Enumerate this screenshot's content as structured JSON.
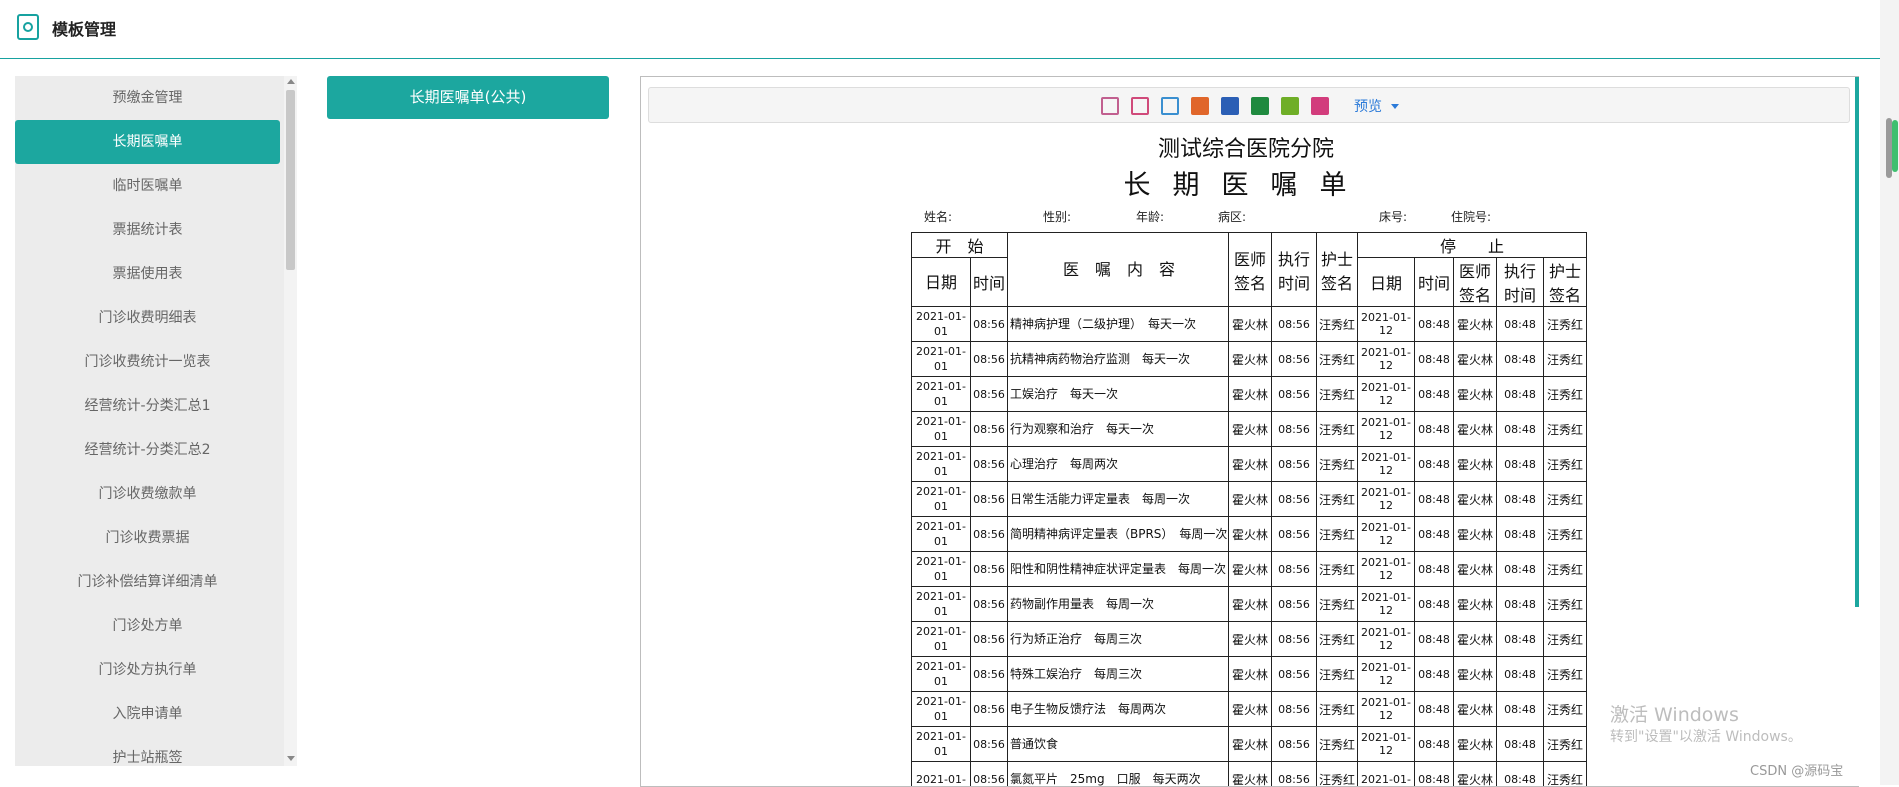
{
  "app": {
    "title": "模板管理"
  },
  "sidebar": {
    "items": [
      {
        "label": "预缴金管理"
      },
      {
        "label": "长期医嘱单",
        "active": true
      },
      {
        "label": "临时医嘱单"
      },
      {
        "label": "票据统计表"
      },
      {
        "label": "票据使用表"
      },
      {
        "label": "门诊收费明细表"
      },
      {
        "label": "门诊收费统计一览表"
      },
      {
        "label": "经营统计-分类汇总1"
      },
      {
        "label": "经营统计-分类汇总2"
      },
      {
        "label": "门诊收费缴款单"
      },
      {
        "label": "门诊收费票据"
      },
      {
        "label": "门诊补偿结算详细清单"
      },
      {
        "label": "门诊处方单"
      },
      {
        "label": "门诊处方执行单"
      },
      {
        "label": "入院申请单"
      },
      {
        "label": "护士站瓶签"
      }
    ]
  },
  "template_button": {
    "label": "长期医嘱单(公共)"
  },
  "toolbar": {
    "icons": [
      {
        "name": "print-preview-icon",
        "color": "#c15f8f"
      },
      {
        "name": "print-icon",
        "color": "#d04a7a"
      },
      {
        "name": "quick-print-icon",
        "color": "#3a8fd0"
      },
      {
        "name": "pdf-icon",
        "color": "#e0662a"
      },
      {
        "name": "word-icon",
        "color": "#2b5fb5"
      },
      {
        "name": "excel-icon",
        "color": "#1f8a3f"
      },
      {
        "name": "excel-green-icon",
        "color": "#6fae27"
      },
      {
        "name": "excel-pink-icon",
        "color": "#d23c7c"
      }
    ],
    "preview_label": "预览"
  },
  "report": {
    "hospital": "测试综合医院分院",
    "title": "长期医嘱单",
    "patient": {
      "name_label": "姓名:",
      "gender_label": "性别:",
      "age_label": "年龄:",
      "ward_label": "病区:",
      "bed_label": "床号:",
      "admission_label": "住院号:"
    },
    "headers": {
      "start": "开　始",
      "stop": "停　　止",
      "content": "医　嘱　内　容",
      "date": "日期",
      "time": "时间",
      "doctor_sig": "医师签名",
      "exec_time": "执行时间",
      "nurse_sig": "护士签名"
    },
    "rows": [
      {
        "d1": "2021-01-01",
        "t1": "08:56",
        "content": "精神病护理（二级护理）　每天一次",
        "doc": "霍火林",
        "exec": "08:56",
        "nurse": "汪秀红",
        "d2": "2021-01-12",
        "t2": "08:48",
        "doc2": "霍火林",
        "exec2": "08:48",
        "nurse2": "汪秀红"
      },
      {
        "d1": "2021-01-01",
        "t1": "08:56",
        "content": "抗精神病药物治疗监测　每天一次",
        "doc": "霍火林",
        "exec": "08:56",
        "nurse": "汪秀红",
        "d2": "2021-01-12",
        "t2": "08:48",
        "doc2": "霍火林",
        "exec2": "08:48",
        "nurse2": "汪秀红"
      },
      {
        "d1": "2021-01-01",
        "t1": "08:56",
        "content": "工娱治疗　每天一次",
        "doc": "霍火林",
        "exec": "08:56",
        "nurse": "汪秀红",
        "d2": "2021-01-12",
        "t2": "08:48",
        "doc2": "霍火林",
        "exec2": "08:48",
        "nurse2": "汪秀红"
      },
      {
        "d1": "2021-01-01",
        "t1": "08:56",
        "content": "行为观察和治疗　每天一次",
        "doc": "霍火林",
        "exec": "08:56",
        "nurse": "汪秀红",
        "d2": "2021-01-12",
        "t2": "08:48",
        "doc2": "霍火林",
        "exec2": "08:48",
        "nurse2": "汪秀红"
      },
      {
        "d1": "2021-01-01",
        "t1": "08:56",
        "content": "心理治疗　每周两次",
        "doc": "霍火林",
        "exec": "08:56",
        "nurse": "汪秀红",
        "d2": "2021-01-12",
        "t2": "08:48",
        "doc2": "霍火林",
        "exec2": "08:48",
        "nurse2": "汪秀红"
      },
      {
        "d1": "2021-01-01",
        "t1": "08:56",
        "content": "日常生活能力评定量表　每周一次",
        "doc": "霍火林",
        "exec": "08:56",
        "nurse": "汪秀红",
        "d2": "2021-01-12",
        "t2": "08:48",
        "doc2": "霍火林",
        "exec2": "08:48",
        "nurse2": "汪秀红"
      },
      {
        "d1": "2021-01-01",
        "t1": "08:56",
        "content": "简明精神病评定量表（BPRS）　每周一次",
        "doc": "霍火林",
        "exec": "08:56",
        "nurse": "汪秀红",
        "d2": "2021-01-12",
        "t2": "08:48",
        "doc2": "霍火林",
        "exec2": "08:48",
        "nurse2": "汪秀红"
      },
      {
        "d1": "2021-01-01",
        "t1": "08:56",
        "content": "阳性和阴性精神症状评定量表　每周一次",
        "doc": "霍火林",
        "exec": "08:56",
        "nurse": "汪秀红",
        "d2": "2021-01-12",
        "t2": "08:48",
        "doc2": "霍火林",
        "exec2": "08:48",
        "nurse2": "汪秀红"
      },
      {
        "d1": "2021-01-01",
        "t1": "08:56",
        "content": "药物副作用量表　每周一次",
        "doc": "霍火林",
        "exec": "08:56",
        "nurse": "汪秀红",
        "d2": "2021-01-12",
        "t2": "08:48",
        "doc2": "霍火林",
        "exec2": "08:48",
        "nurse2": "汪秀红"
      },
      {
        "d1": "2021-01-01",
        "t1": "08:56",
        "content": "行为矫正治疗　每周三次",
        "doc": "霍火林",
        "exec": "08:56",
        "nurse": "汪秀红",
        "d2": "2021-01-12",
        "t2": "08:48",
        "doc2": "霍火林",
        "exec2": "08:48",
        "nurse2": "汪秀红"
      },
      {
        "d1": "2021-01-01",
        "t1": "08:56",
        "content": "特殊工娱治疗　每周三次",
        "doc": "霍火林",
        "exec": "08:56",
        "nurse": "汪秀红",
        "d2": "2021-01-12",
        "t2": "08:48",
        "doc2": "霍火林",
        "exec2": "08:48",
        "nurse2": "汪秀红"
      },
      {
        "d1": "2021-01-01",
        "t1": "08:56",
        "content": "电子生物反馈疗法　每周两次",
        "doc": "霍火林",
        "exec": "08:56",
        "nurse": "汪秀红",
        "d2": "2021-01-12",
        "t2": "08:48",
        "doc2": "霍火林",
        "exec2": "08:48",
        "nurse2": "汪秀红"
      },
      {
        "d1": "2021-01-01",
        "t1": "08:56",
        "content": "普通饮食",
        "doc": "霍火林",
        "exec": "08:56",
        "nurse": "汪秀红",
        "d2": "2021-01-12",
        "t2": "08:48",
        "doc2": "霍火林",
        "exec2": "08:48",
        "nurse2": "汪秀红"
      },
      {
        "d1": "2021-01-",
        "t1": "08:56",
        "content": "氯氮平片　25mg　口服　每天两次",
        "doc": "霍火林",
        "exec": "08:56",
        "nurse": "汪秀红",
        "d2": "2021-01-",
        "t2": "08:48",
        "doc2": "霍火林",
        "exec2": "08:48",
        "nurse2": "汪秀红"
      }
    ]
  },
  "watermark": {
    "line1": "激活 Windows",
    "line2": "转到\"设置\"以激活 Windows。"
  },
  "csdn": "CSDN @源码宝"
}
